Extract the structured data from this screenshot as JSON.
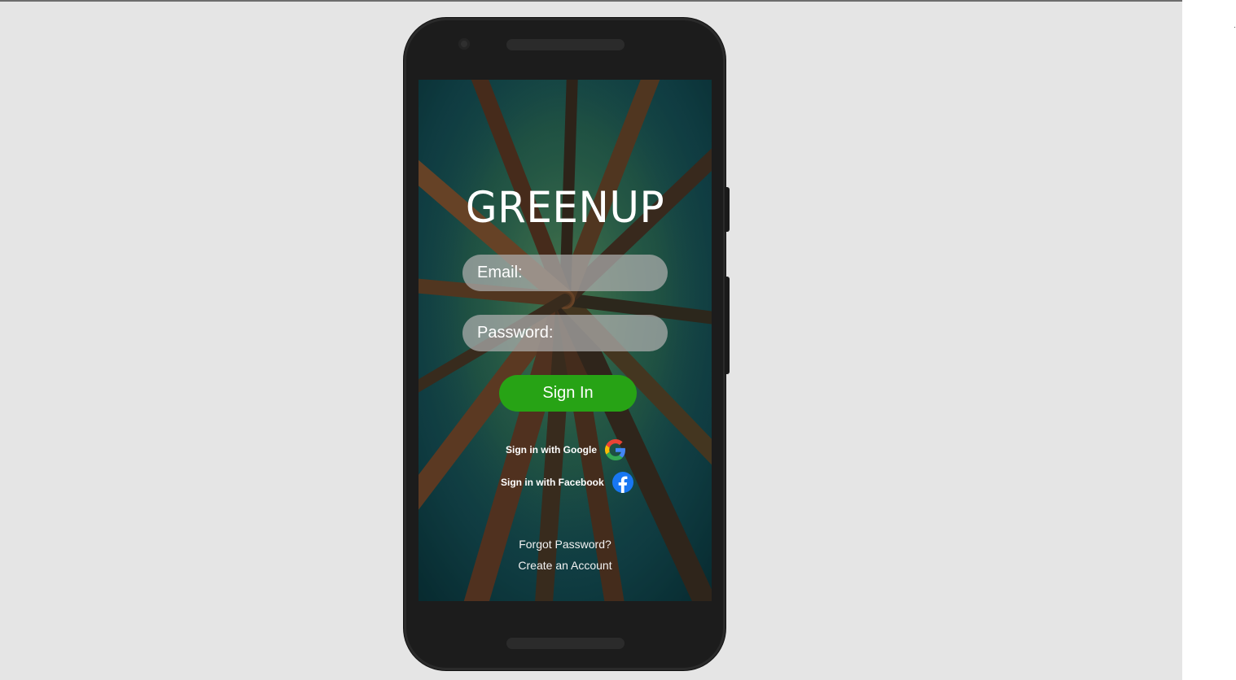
{
  "app": {
    "title": "GREENUP"
  },
  "login": {
    "email_placeholder": "Email:",
    "password_placeholder": "Password:",
    "signin_label": "Sign In"
  },
  "social": {
    "google_label": "Sign in with Google",
    "facebook_label": "Sign in with Facebook",
    "google_icon": "google-g-icon",
    "facebook_icon": "facebook-f-icon"
  },
  "links": {
    "forgot_password": "Forgot Password?",
    "create_account": "Create an Account"
  },
  "colors": {
    "signin_button": "#27a315",
    "field_background": "#afafaf",
    "facebook_blue": "#1877f2",
    "canvas_background": "#e5e5e5",
    "phone_body": "#1c1c1c"
  }
}
